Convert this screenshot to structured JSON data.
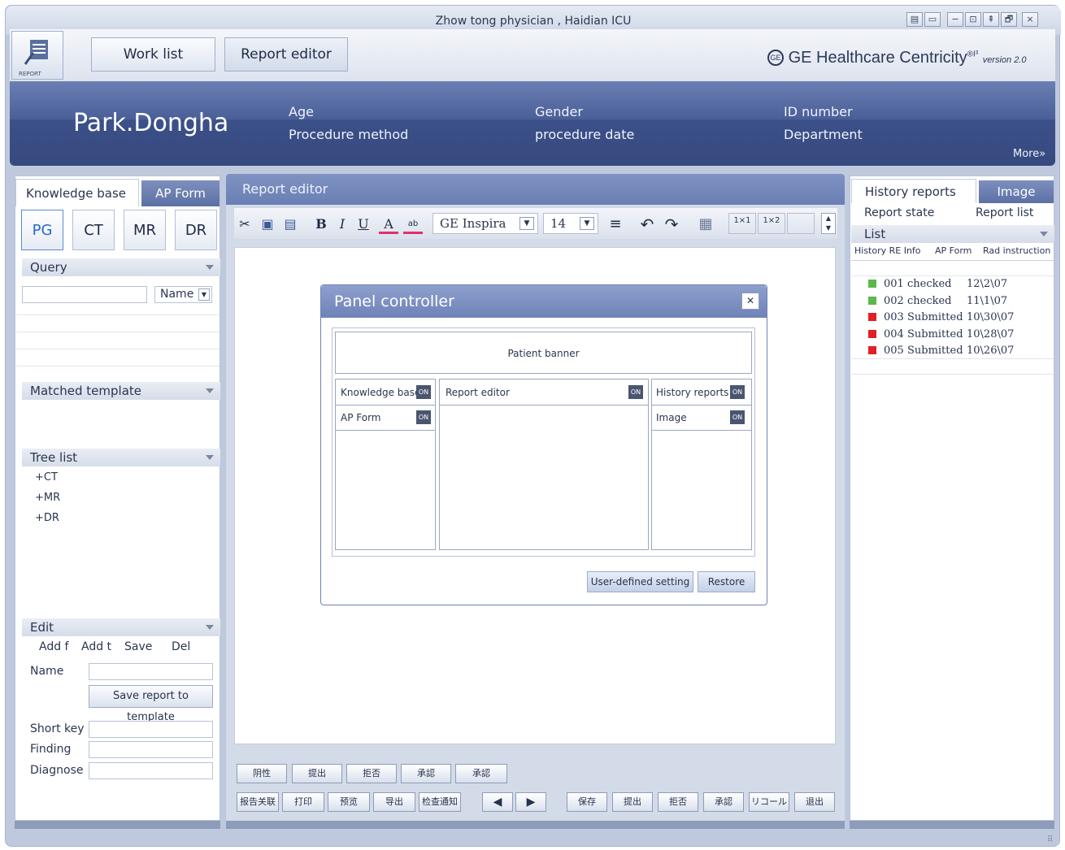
{
  "window": {
    "title": "Zhow tong physician , Haidian ICU",
    "controls": [
      "▤",
      "▭",
      "−",
      "⊡",
      "⇞",
      "🗗",
      "×"
    ]
  },
  "topnav": {
    "logo_caption": "REPORT",
    "worklist_label": "Work list",
    "report_editor_label": "Report editor",
    "brand": "GE Healthcare Centricity",
    "brand_sup": "®I³",
    "version": "version 2.0"
  },
  "patient": {
    "name": "Park.Dongha",
    "fields": [
      "Age",
      "Gender",
      "ID number",
      "Procedure method",
      "procedure date",
      "Department"
    ],
    "more": "More»"
  },
  "left": {
    "tabs": [
      "Knowledge base",
      "AP Form"
    ],
    "modalities": [
      "PG",
      "CT",
      "MR",
      "DR"
    ],
    "query": {
      "title": "Query",
      "select": "Name"
    },
    "matched": {
      "title": "Matched template"
    },
    "tree": {
      "title": "Tree list",
      "items": [
        "+CT",
        "+MR",
        "+DR"
      ]
    },
    "edit": {
      "title": "Edit",
      "buttons": [
        "Add f",
        "Add t",
        "Save",
        "Del"
      ],
      "name_label": "Name",
      "save_template": "Save report to template",
      "short_key": "Short key",
      "finding": "Finding",
      "diagnose": "Diagnose"
    }
  },
  "editor": {
    "title": "Report editor",
    "font": "GE Inspira",
    "size": "14",
    "buttons1": [
      "阴性",
      "提出",
      "拒否",
      "承認",
      "承認"
    ],
    "buttons2": [
      "报告关联",
      "打印",
      "预览",
      "导出",
      "检查通知",
      "保存",
      "提出",
      "拒否",
      "承認",
      "リコール",
      "退出"
    ]
  },
  "dialog": {
    "title": "Panel controller",
    "banner": "Patient banner",
    "on": "ON",
    "kb": "Knowledge base",
    "ap": "AP Form",
    "re": "Report editor",
    "hr": "History reports",
    "img": "Image",
    "user_btn": "User-defined setting",
    "restore": "Restore"
  },
  "right": {
    "tabs": [
      "History reports",
      "Image"
    ],
    "report_state": "Report state",
    "report_list": "Report list",
    "list": "List",
    "subtabs": [
      "History RE Info",
      "AP Form",
      "Rad instruction"
    ],
    "rows": [
      {
        "id": "001",
        "state": "checked",
        "date": "12\\2\\07",
        "color": "#5cb84a"
      },
      {
        "id": "002",
        "state": "checked",
        "date": "11\\1\\07",
        "color": "#5cb84a"
      },
      {
        "id": "003",
        "state": "Submitted",
        "date": "10\\30\\07",
        "color": "#e01f26"
      },
      {
        "id": "004",
        "state": "Submitted",
        "date": "10\\28\\07",
        "color": "#e01f26"
      },
      {
        "id": "005",
        "state": "Submitted",
        "date": "10\\26\\07",
        "color": "#e01f26"
      }
    ]
  }
}
